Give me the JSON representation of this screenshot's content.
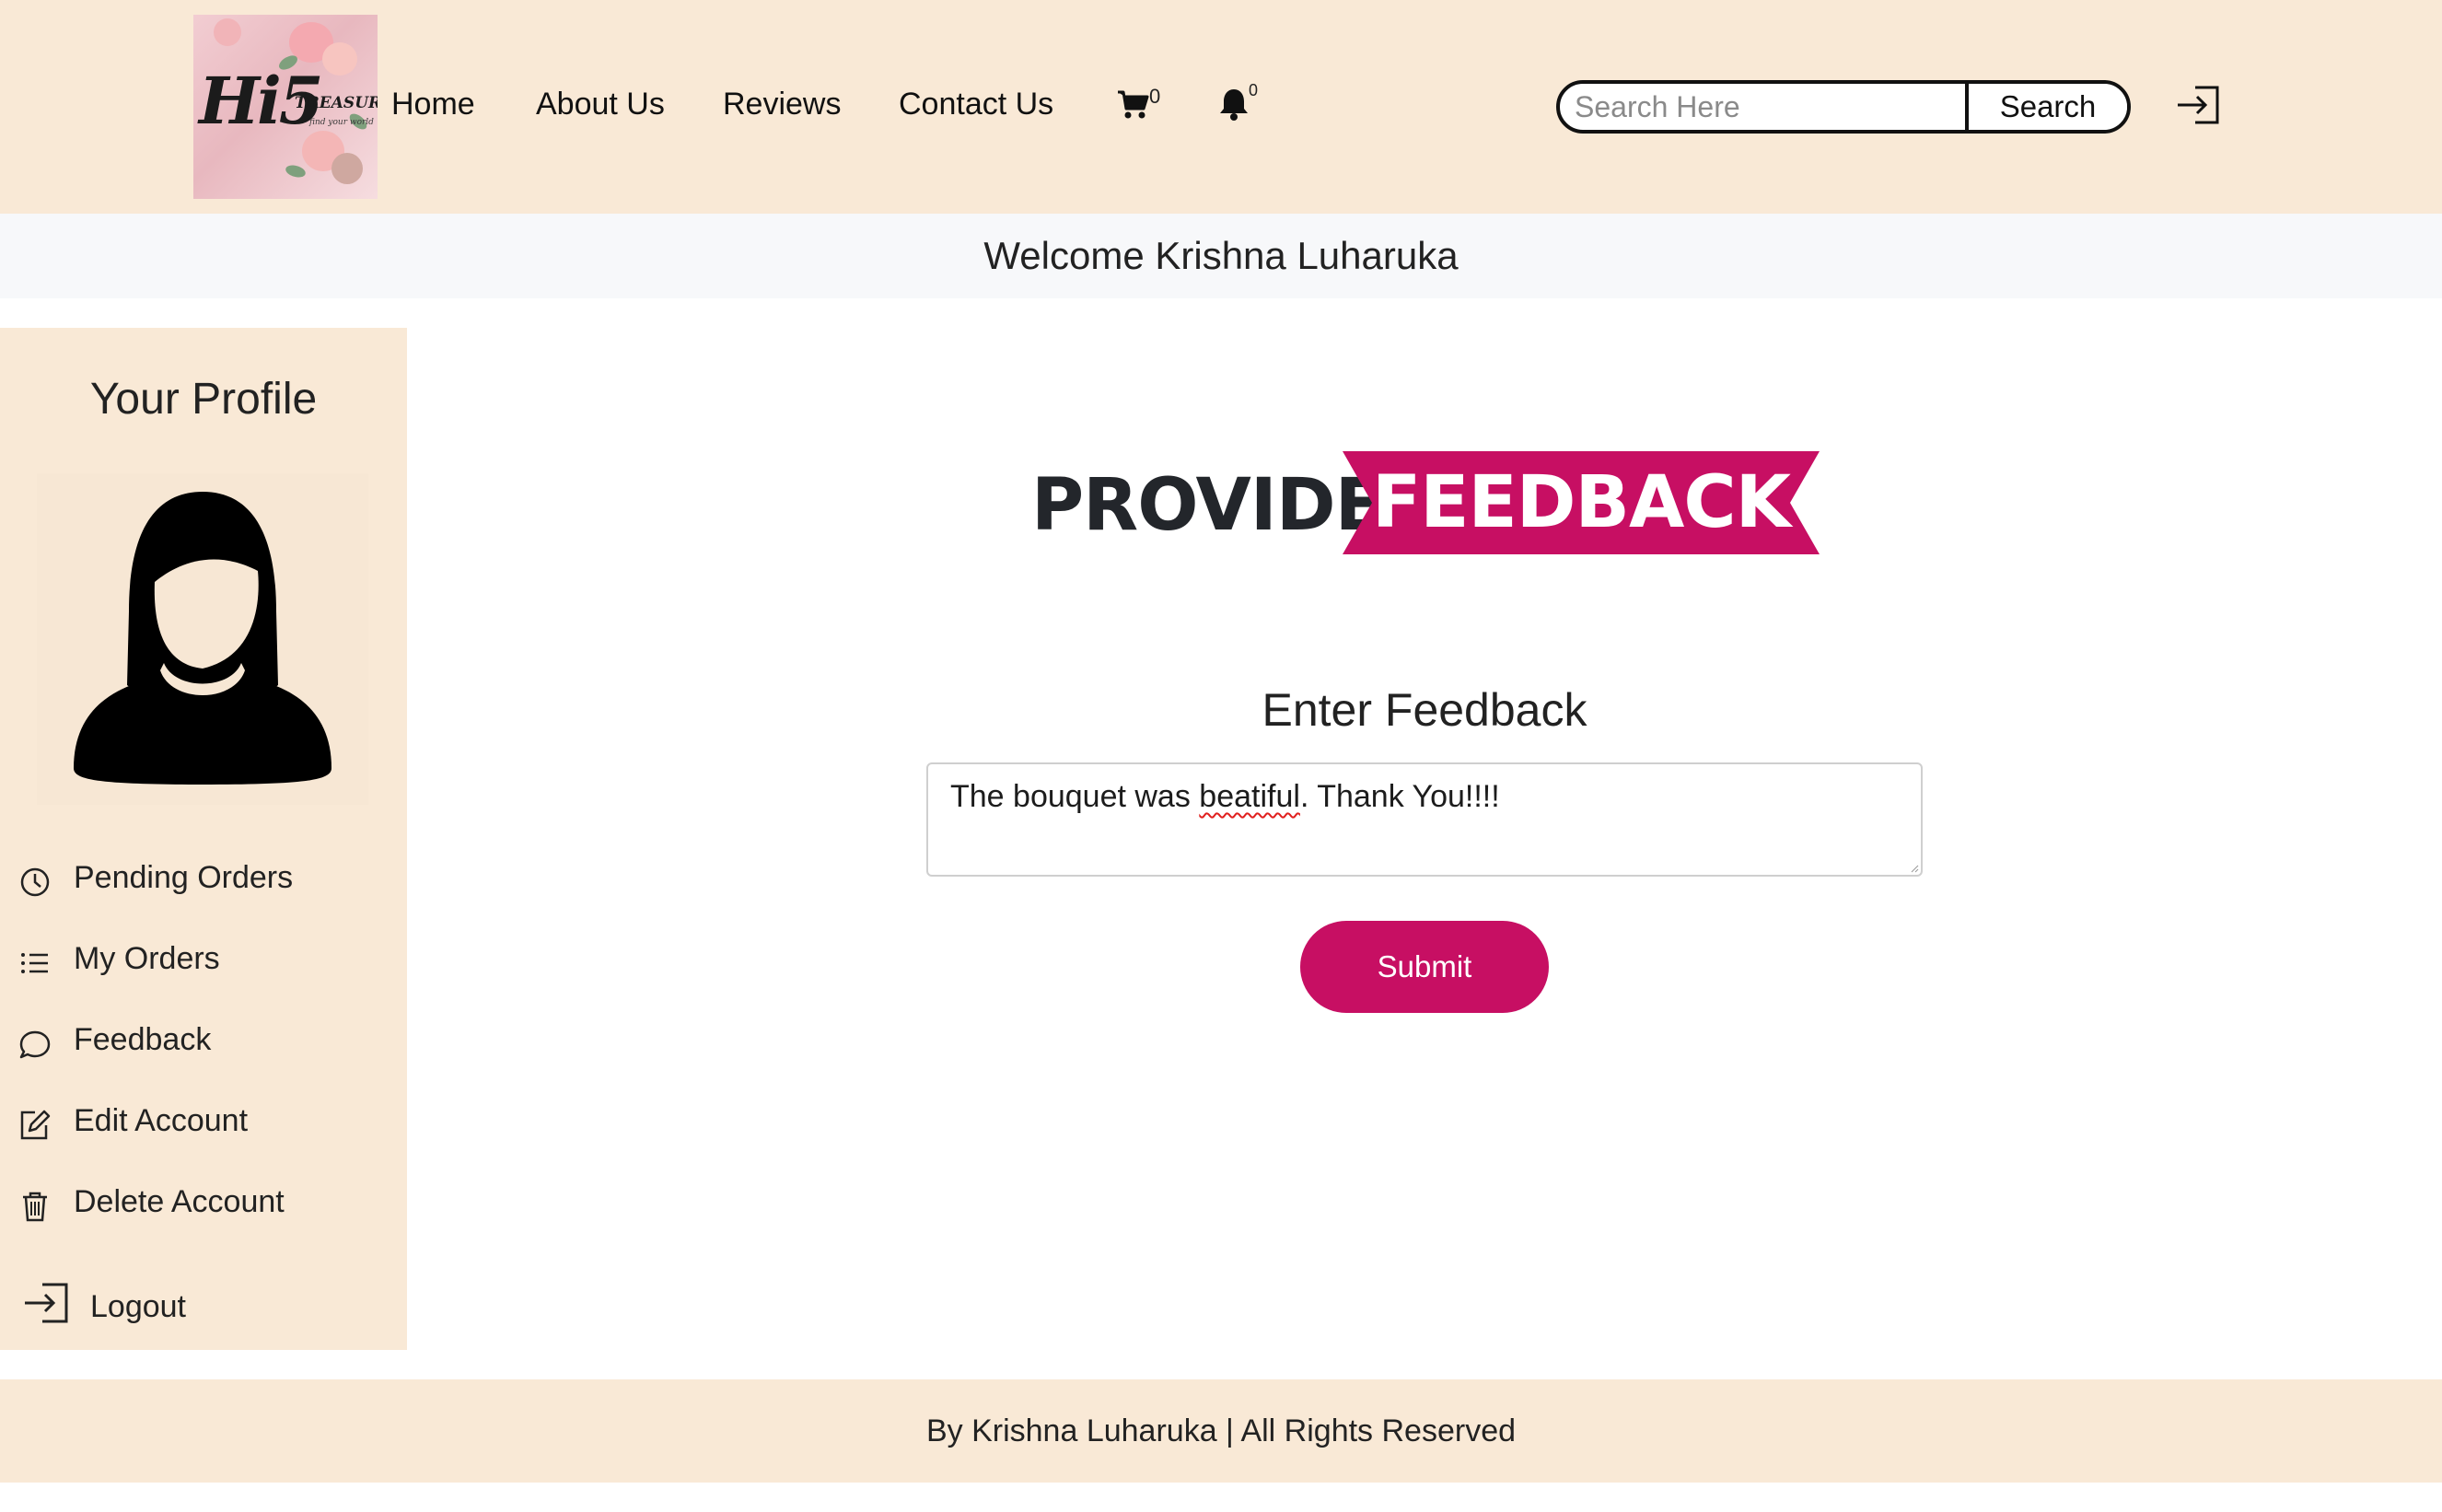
{
  "brand": {
    "logo_main": "Hi5",
    "logo_sub": "TREASURES",
    "logo_tagline": "find your world"
  },
  "nav": {
    "home": "Home",
    "about": "About Us",
    "reviews": "Reviews",
    "contact": "Contact Us",
    "cart_count": "0",
    "notification_count": "0"
  },
  "search": {
    "placeholder": "Search Here",
    "value": "",
    "button_label": "Search"
  },
  "welcome": "Welcome Krishna Luharuka",
  "sidebar": {
    "title": "Your Profile",
    "items": [
      {
        "label": "Pending Orders",
        "icon": "clock-icon"
      },
      {
        "label": "My Orders",
        "icon": "list-icon"
      },
      {
        "label": "Feedback",
        "icon": "chat-bubble-icon"
      },
      {
        "label": "Edit Account",
        "icon": "edit-icon"
      },
      {
        "label": "Delete Account",
        "icon": "trash-icon"
      },
      {
        "label": "Logout",
        "icon": "logout-icon"
      }
    ]
  },
  "main": {
    "heading_left": "PROVIDE",
    "heading_right": "FEEDBACK",
    "feedback_label": "Enter Feedback",
    "feedback_text_before": "The bouquet was ",
    "feedback_misspelled": "beatiful",
    "feedback_text_after": ". Thank You!!!!",
    "submit_label": "Submit"
  },
  "footer": "By Krishna Luharuka | All Rights Reserved",
  "colors": {
    "header_bg": "#f9e9d6",
    "accent": "#c70f63",
    "welcome_bg": "#f7f8fa"
  }
}
